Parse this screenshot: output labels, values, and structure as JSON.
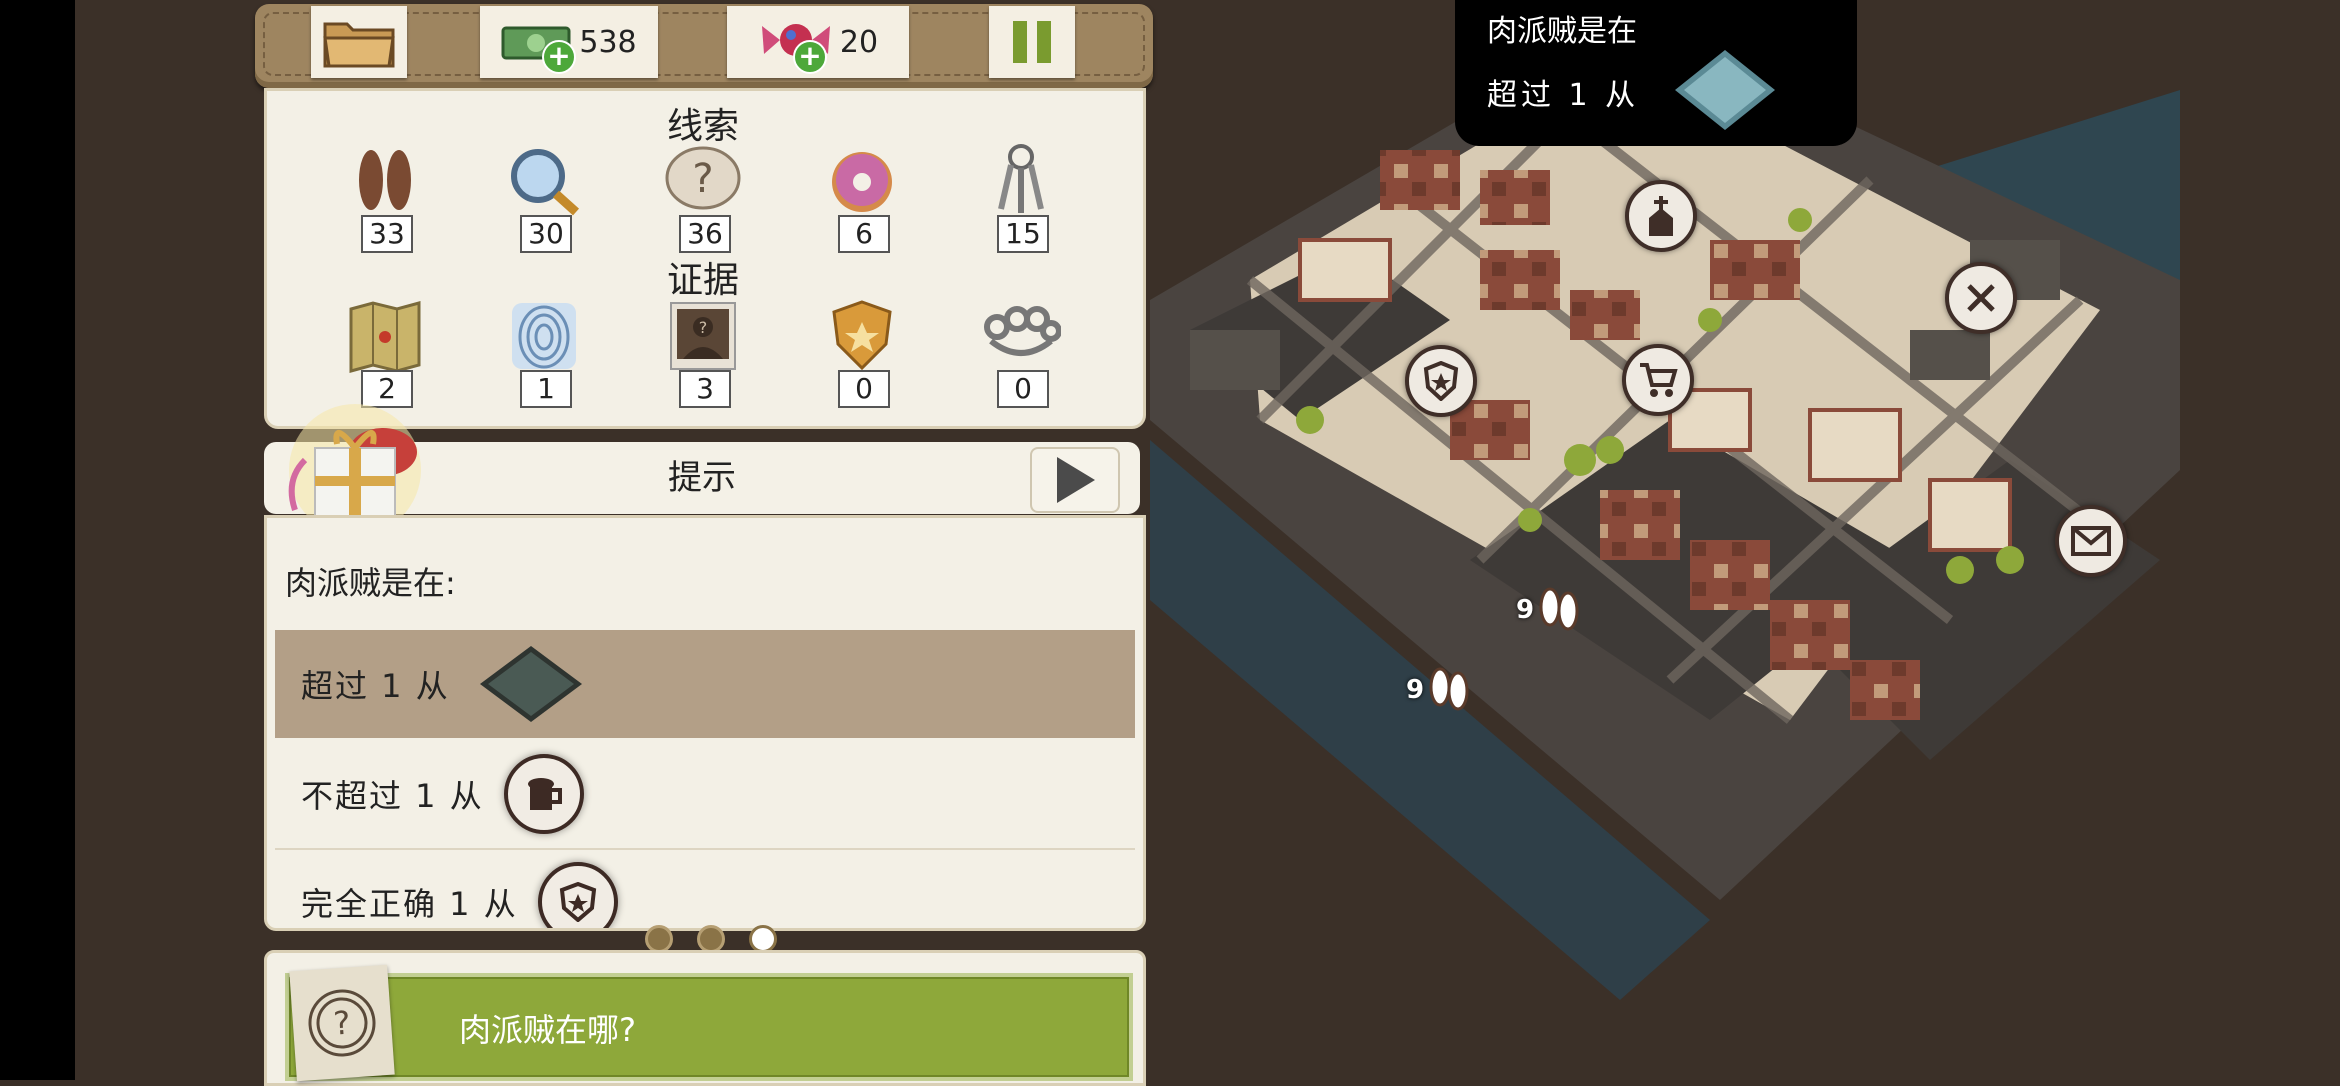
{
  "topbar": {
    "money_count": "538",
    "candy_count": "20",
    "folder_icon": "folder-icon",
    "money_icon": "banknote-icon",
    "candy_icon": "candy-icon",
    "pause_icon": "pause-icon"
  },
  "clues": {
    "title": "线索",
    "items": [
      {
        "icon": "footprints-icon",
        "count": "33"
      },
      {
        "icon": "magnifier-icon",
        "count": "30"
      },
      {
        "icon": "question-bubble-icon",
        "count": "36"
      },
      {
        "icon": "donut-icon",
        "count": "6"
      },
      {
        "icon": "keys-icon",
        "count": "15"
      }
    ]
  },
  "evidence": {
    "title": "证据",
    "items": [
      {
        "icon": "map-icon",
        "count": "2"
      },
      {
        "icon": "fingerprint-icon",
        "count": "1"
      },
      {
        "icon": "mystery-photo-icon",
        "count": "3"
      },
      {
        "icon": "police-badge-icon",
        "count": "0"
      },
      {
        "icon": "brass-knuckles-icon",
        "count": "0"
      }
    ]
  },
  "hint": {
    "title": "提示",
    "header": "肉派贼是在:",
    "rows": [
      {
        "text": "超过 1 从",
        "icon": "tile-icon",
        "selected": true
      },
      {
        "text": "不超过 1 从",
        "icon": "beer-mug-icon",
        "selected": false
      },
      {
        "text": "完全正确 1 从",
        "icon": "police-badge-icon",
        "selected": false
      }
    ],
    "page_dots": 3,
    "active_dot": 3
  },
  "question": {
    "text": "肉派贼在哪?"
  },
  "tooltip": {
    "line1": "肉派贼是在",
    "line2": "超过 1 从"
  },
  "map": {
    "markers": [
      {
        "icon": "church-icon"
      },
      {
        "icon": "fork-knife-icon"
      },
      {
        "icon": "police-badge-icon"
      },
      {
        "icon": "shopping-cart-icon"
      },
      {
        "icon": "mail-icon"
      }
    ],
    "footprints": [
      {
        "count": "9"
      },
      {
        "count": "9"
      }
    ]
  },
  "colors": {
    "selected_row": "#b39f87",
    "question_bar": "#8ea83a",
    "frame": "#8a7347"
  }
}
